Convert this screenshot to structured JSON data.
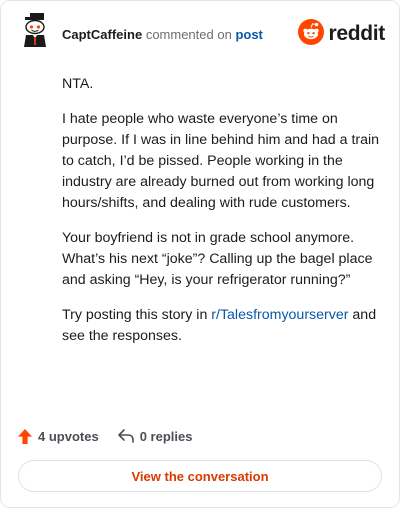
{
  "header": {
    "username": "CaptCaffeine",
    "action_text": "commented on",
    "target_text": "post",
    "brand": "reddit"
  },
  "comment": {
    "paragraphs": [
      {
        "text": "NTA."
      },
      {
        "text": "I hate people who waste everyone’s time on purpose. If I was in line behind him and had a train to catch, I’d be pissed. People working in the industry are already burned out from working long hours/shifts, and dealing with rude customers."
      },
      {
        "text": "Your boyfriend is not in grade school anymore. What’s his next “joke”? Calling up the bagel place and asking “Hey, is your refrigerator running?”"
      },
      {
        "prefix": "Try posting this story in ",
        "link": "r/Talesfromyourserver",
        "suffix": " and see the responses."
      }
    ]
  },
  "footer": {
    "upvotes": "4 upvotes",
    "replies": "0 replies",
    "cta": "View the conversation"
  },
  "colors": {
    "accent": "#d93a00",
    "upvote": "#ff4500",
    "link": "#0a58a8",
    "text": "#1c1c1c",
    "muted": "#6a6f73"
  },
  "icons": {
    "avatar": "snoo-avatar-icon",
    "brand": "reddit-logo-icon",
    "upvote": "upvote-arrow-icon",
    "reply": "reply-arrow-icon"
  }
}
